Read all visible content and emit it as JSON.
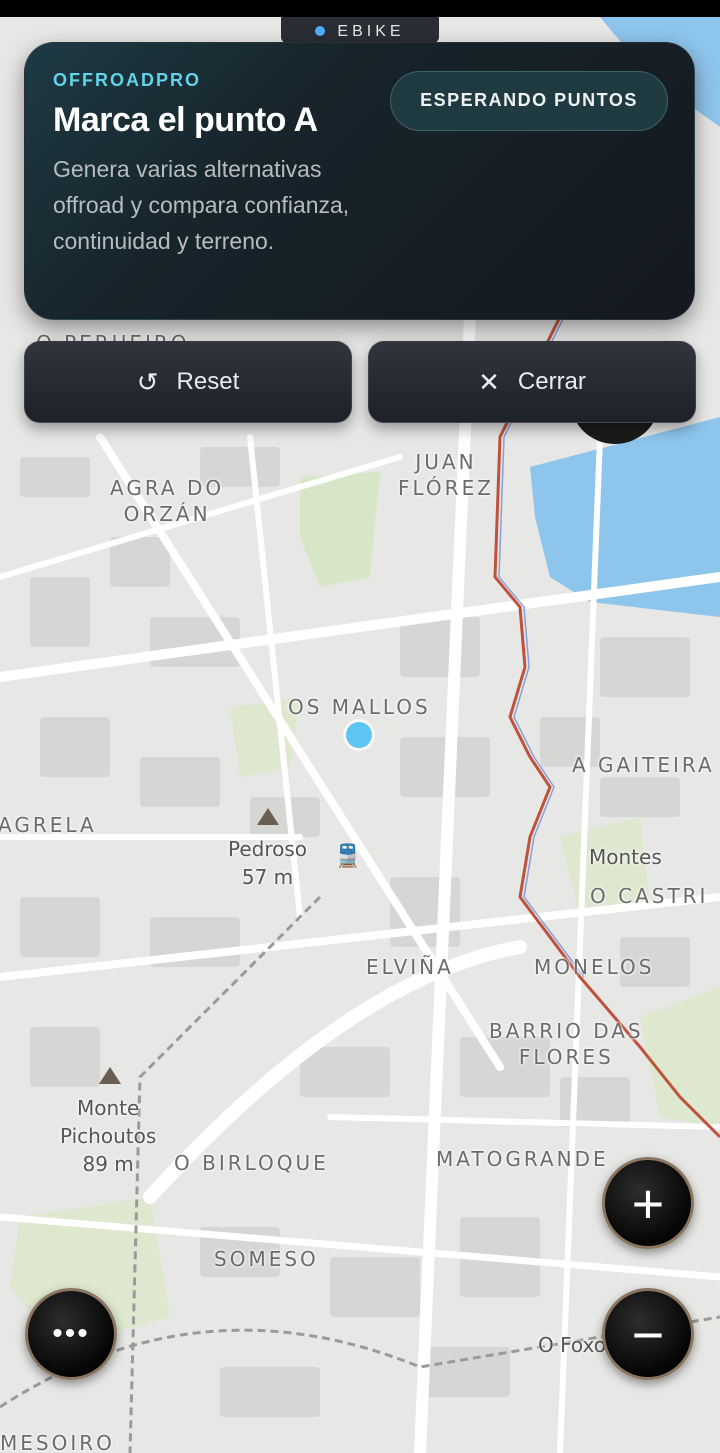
{
  "top_tab": {
    "label": "EBIKE"
  },
  "card": {
    "brand": "OFFROADPRO",
    "title": "Marca el punto A",
    "description": "Genera varias alternativas offroad y compara confianza, continuidad y terreno.",
    "status": "ESPERANDO PUNTOS"
  },
  "buttons": {
    "reset": {
      "icon": "↺",
      "label": "Reset"
    },
    "close": {
      "icon": "✕",
      "label": "Cerrar"
    }
  },
  "map": {
    "labels": {
      "juan_florez": "JUAN\nFLÓREZ",
      "agra_orzan": "AGRA DO\nORZÁN",
      "os_mallos": "OS MALLOS",
      "a_gaiteira": "A GAITEIRA",
      "agrela": "AGRELA",
      "o_castri": "O CASTRI",
      "elvina": "ELVIÑA",
      "monelos": "MONELOS",
      "barrio_flores": "BARRIO DAS\nFLORES",
      "o_birloque": "O BIRLOQUE",
      "matogrande": "MATOGRANDE",
      "someso": "SOMESO",
      "mesoiro": "MESOIRO",
      "o_perueiro": "O PERUEIRO"
    },
    "pois": {
      "pedroso": "Pedroso\n57 m",
      "montes": "Montes",
      "pichoutos": "Monte\nPichoutos\n89 m",
      "o_foxo": "O Foxo"
    }
  },
  "controls": {
    "zoom_in": "+",
    "zoom_out": "−",
    "more": "•••"
  },
  "colors": {
    "accent": "#62d3e8",
    "route": "#c0513a",
    "water": "#8ec5ec",
    "park": "#d8e6c8"
  }
}
